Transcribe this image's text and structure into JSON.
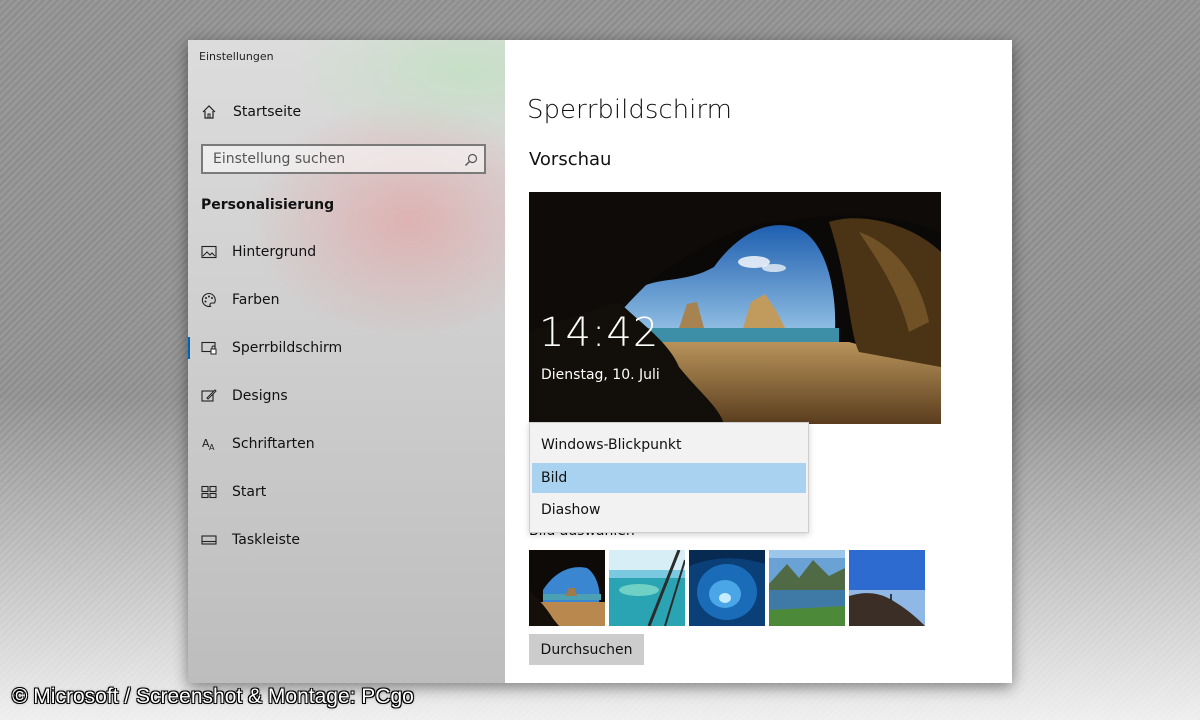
{
  "window": {
    "title": "Einstellungen"
  },
  "sidebar": {
    "home_label": "Startseite",
    "search_placeholder": "Einstellung suchen",
    "section_title": "Personalisierung",
    "items": [
      {
        "label": "Hintergrund",
        "icon": "image-icon"
      },
      {
        "label": "Farben",
        "icon": "palette-icon"
      },
      {
        "label": "Sperrbildschirm",
        "icon": "lock-screen-icon",
        "active": true
      },
      {
        "label": "Designs",
        "icon": "pencil-icon"
      },
      {
        "label": "Schriftarten",
        "icon": "font-icon"
      },
      {
        "label": "Start",
        "icon": "start-grid-icon"
      },
      {
        "label": "Taskleiste",
        "icon": "taskbar-icon"
      }
    ]
  },
  "content": {
    "page_title": "Sperrbildschirm",
    "preview_title": "Vorschau",
    "preview": {
      "time": "14:42",
      "date": "Dienstag, 10. Juli"
    },
    "background_dropdown": {
      "options": [
        "Windows-Blickpunkt",
        "Bild",
        "Diashow"
      ],
      "selected": "Bild"
    },
    "choose_picture_label": "Bild auswählen",
    "thumbnails": [
      "cave-beach",
      "sea-glass",
      "ice-cave",
      "mountain-lake",
      "cliff-sky"
    ],
    "browse_button": "Durchsuchen"
  },
  "credit": "© Microsoft / Screenshot & Montage: PCgo",
  "colors": {
    "accent": "#0063b1",
    "dropdown_selected": "#a9d2f0",
    "button": "#cccccc"
  }
}
